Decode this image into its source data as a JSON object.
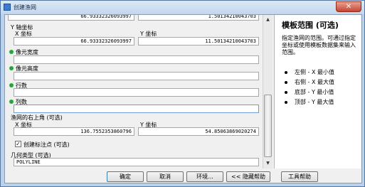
{
  "window": {
    "title": "创建渔网",
    "close_glyph": "✕"
  },
  "form": {
    "prev_values": {
      "x": "66.93332326093997",
      "y": "1.50134210043703"
    },
    "y_axis_title": "Y 轴坐标",
    "x_label": "X 坐标",
    "y_label": "Y 坐标",
    "y_axis_x": "66.93332326093997",
    "y_axis_y": "11.50134210043703",
    "cell_width_label": "像元宽度",
    "cell_width_value": "",
    "cell_height_label": "像元高度",
    "cell_height_value": "",
    "rows_label": "行数",
    "rows_value": "",
    "cols_label": "列数",
    "cols_value": "",
    "upper_right_title": "渔网的右上角 (可选)",
    "ur_x": "136.7552353860796",
    "ur_y": "54.85063869020274",
    "create_points_label": "创建标注点 (可选)",
    "create_points_checked": true,
    "check_glyph": "✓",
    "geometry_label": "几何类型 (可选)",
    "geometry_value": "POLYLINE",
    "required_dot_color": "#25a83b"
  },
  "scrollbar": {
    "up_glyph": "▲",
    "down_glyph": "▼"
  },
  "help": {
    "title": "模板范围 (可选)",
    "description": "指定渔网的范围。可通过指定坐标或使用模板数据集来输入范围。",
    "items": [
      "左侧 - X 最小值",
      "右侧 - X 最大值",
      "底部 - Y 最小值",
      "顶部 - Y 最大值"
    ]
  },
  "buttons": {
    "ok": "确定",
    "cancel": "取消",
    "environments": "环境...",
    "hide_help": "<< 隐藏帮助",
    "tool_help": "工具帮助"
  }
}
